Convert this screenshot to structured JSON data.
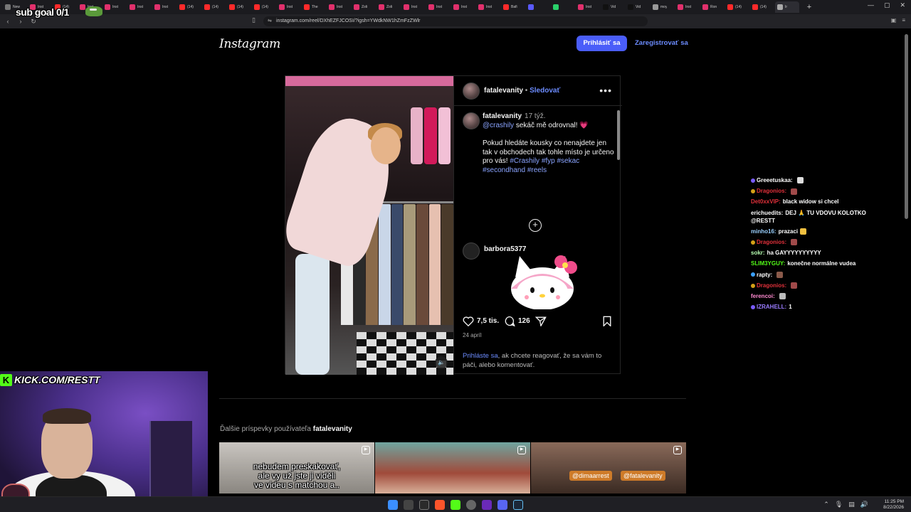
{
  "overlay": {
    "sub_goal": "sub goal 0/1",
    "kick_label": "KICK.COM/RESTT"
  },
  "browser": {
    "url": "instagram.com/reel/DXhEZFJCOSI/?igsh=YWdkNW1hZmFzZWlr",
    "tabs": [
      "New",
      "Inst",
      "(14)",
      "Inst",
      "Inst",
      "Inst",
      "Inst",
      "(14)",
      "(14)",
      "(14)",
      "(14)",
      "Inst",
      "The",
      "Inst",
      "Zoli",
      "Zoli",
      "Inst",
      "Inst",
      "Inst",
      "Inst",
      "Bafi",
      "",
      "",
      "Inst",
      "Vid",
      "Vid",
      "moy",
      "Inst",
      "Ron",
      "(14)",
      "(14)",
      "Ir"
    ]
  },
  "instagram": {
    "logo": "Instagram",
    "login_button": "Prihlásiť sa",
    "register_link": "Zaregistrovať sa"
  },
  "post": {
    "author": "fatalevanity",
    "separator": " • ",
    "follow": "Sledovať",
    "caption_author": "fatalevanity",
    "caption_time": "17 týž.",
    "caption_mention": "@crashily",
    "caption_line1_rest": " sekáč mě odrovnal! 💗",
    "caption_body": "Pokud hledáte kousky co nenajdete jen tak v obchodech tak tohle místo je určeno pro vás!",
    "caption_tags": " #Crashily #fyp #sekac #secondhand #reels",
    "comment_user": "barbora5377",
    "likes": "7,5 tis.",
    "comments_count": "126",
    "date": "24 apríl",
    "login_prompt_link": "Prihláste sa",
    "login_prompt_rest": ", ak chcete reagovať, že sa vám to páči, alebo komentovať."
  },
  "more_posts": {
    "prefix": "Ďalšie príspevky používateľa ",
    "user": "fatalevanity",
    "thumb1_caption": "nebudem preskakovať,\nale vy už jste ji viděli\nve videu s matchou a..",
    "thumb3_tag1": "@dimaarrest",
    "thumb3_tag2": "@fatalevanity"
  },
  "chat": [
    {
      "user": "Greeetuskaa:",
      "msg": "",
      "color": "#ffffff",
      "badge": "#7a5cff",
      "emote": "#dddddd"
    },
    {
      "user": "Dragonios:",
      "msg": "",
      "color": "#e0303a",
      "badge": "#d4a017",
      "emote": "#a04a4a"
    },
    {
      "user": "Det0xxVIP:",
      "msg": "black widow si chcel",
      "color": "#e0303a",
      "badge": "",
      "emote": ""
    },
    {
      "user": "erichuedits:",
      "msg": "DEJ 🙏 TU VDOVU KOLOTKO @RESTT",
      "color": "#ffffff",
      "badge": "",
      "emote": ""
    },
    {
      "user": "minho16:",
      "msg": "prazaci",
      "color": "#9ad0ff",
      "badge": "",
      "emote": "#f0c040"
    },
    {
      "user": "Dragonios:",
      "msg": "",
      "color": "#e0303a",
      "badge": "#d4a017",
      "emote": "#a04a4a"
    },
    {
      "user": "sokr:",
      "msg": "ha GAYYYYYYYYYY",
      "color": "#b6ffb0",
      "badge": "",
      "emote": ""
    },
    {
      "user": "SLIM3YGUY:",
      "msg": "konečne normálne vudea",
      "color": "#53fc18",
      "badge": "",
      "emote": ""
    },
    {
      "user": "rapty:",
      "msg": "",
      "color": "#ffffff",
      "badge": "#3aa0ff",
      "emote": "#8a5a4a"
    },
    {
      "user": "Dragonios:",
      "msg": "",
      "color": "#e0303a",
      "badge": "#d4a017",
      "emote": "#a04a4a"
    },
    {
      "user": "ferencoi:",
      "msg": "",
      "color": "#ff8ad0",
      "badge": "",
      "emote": "#bbbbbb"
    },
    {
      "user": "IZRAHELL:",
      "msg": "1",
      "color": "#9a7cff",
      "badge": "#7a5cff",
      "emote": ""
    }
  ],
  "taskbar": {
    "time": "11:25 PM",
    "date": "8/22/2026"
  },
  "colors": {
    "accent": "#4a5df9",
    "link": "#6c8cff",
    "kick_green": "#53fc18"
  }
}
